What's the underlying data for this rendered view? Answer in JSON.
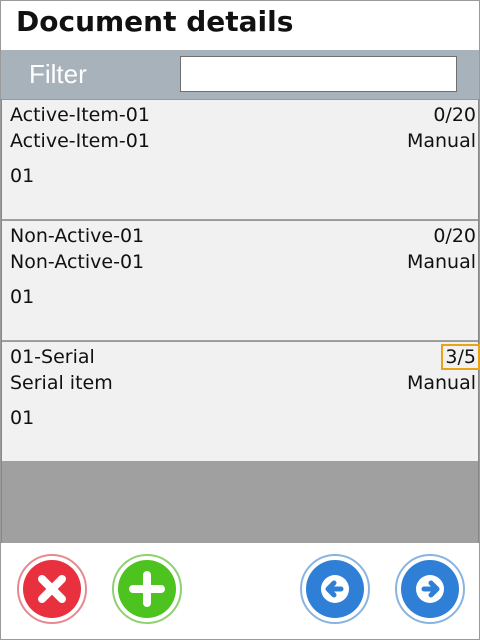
{
  "header": {
    "title": "Document details"
  },
  "filter": {
    "label": "Filter",
    "value": ""
  },
  "items": [
    {
      "code": "Active-Item-01",
      "name": "Active-Item-01",
      "sub": "01",
      "qty": "0/20",
      "mode": "Manual"
    },
    {
      "code": "Non-Active-01",
      "name": "Non-Active-01",
      "sub": "01",
      "qty": "0/20",
      "mode": "Manual"
    },
    {
      "code": "01-Serial",
      "name": "Serial item",
      "sub": "01",
      "qty": "3/5",
      "mode": "Manual"
    }
  ],
  "toolbar": {
    "buttons": [
      {
        "icon": "close-icon",
        "color": "#e8303f"
      },
      {
        "icon": "plus-icon",
        "color": "#4cc31e"
      },
      {
        "icon": "arrow-left-icon",
        "color": "#2f7fd6"
      },
      {
        "icon": "arrow-right-icon",
        "color": "#2f7fd6"
      }
    ]
  },
  "colors": {
    "filter_bar": "#a7b2bb",
    "highlight_outline": "#e8a317",
    "list_background": "#a0a0a0",
    "row_background": "#f1f1f1"
  }
}
